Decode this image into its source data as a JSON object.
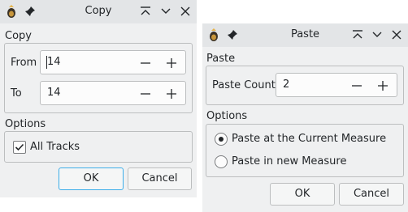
{
  "copy_dialog": {
    "title": "Copy",
    "copy_group_label": "Copy",
    "from_label": "From",
    "from_value": "14",
    "to_label": "To",
    "to_value": "14",
    "options_group_label": "Options",
    "all_tracks_label": "All Tracks",
    "all_tracks_checked": true,
    "ok_label": "OK",
    "cancel_label": "Cancel"
  },
  "paste_dialog": {
    "title": "Paste",
    "paste_group_label": "Paste",
    "paste_count_label": "Paste Count",
    "paste_count_value": "2",
    "options_group_label": "Options",
    "option_current_label": "Paste at the Current Measure",
    "option_new_label": "Paste in new Measure",
    "selected_option": "Paste at the Current Measure",
    "ok_label": "OK",
    "cancel_label": "Cancel"
  },
  "colors": {
    "accent": "#3daee9",
    "window_bg": "#eff0f1",
    "titlebar_bg": "#e3e5e7",
    "text": "#232629"
  },
  "icons": {
    "app": "tuxguitar-app-icon",
    "pin": "pin-icon",
    "keep_above": "keep-above-icon",
    "minimize": "minimize-icon",
    "close": "close-icon",
    "decrement": "minus-icon",
    "increment": "plus-icon"
  }
}
